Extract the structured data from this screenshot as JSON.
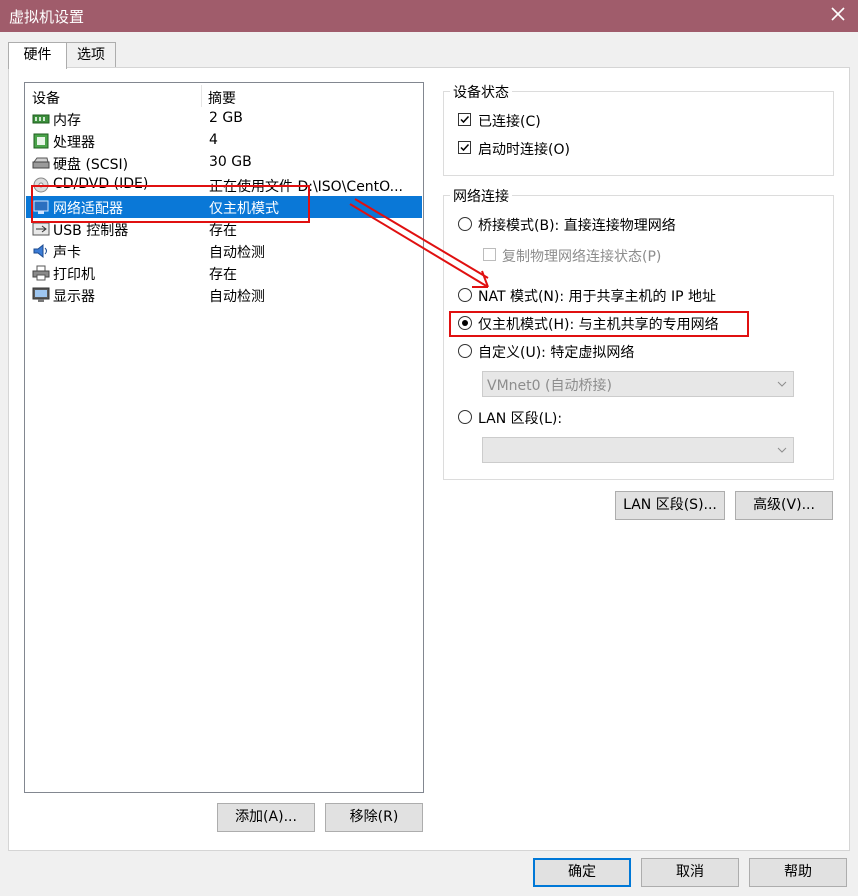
{
  "window": {
    "title": "虚拟机设置",
    "close_icon": "close-icon"
  },
  "tabs": [
    {
      "label": "硬件",
      "active": true
    },
    {
      "label": "选项",
      "active": false
    }
  ],
  "device_list": {
    "columns": [
      "设备",
      "摘要"
    ],
    "rows": [
      {
        "name": "内存",
        "summary": "2 GB",
        "icon": "memory-icon",
        "selected": false
      },
      {
        "name": "处理器",
        "summary": "4",
        "icon": "processor-icon",
        "selected": false
      },
      {
        "name": "硬盘 (SCSI)",
        "summary": "30 GB",
        "icon": "hard-disk-icon",
        "selected": false
      },
      {
        "name": "CD/DVD (IDE)",
        "summary": "正在使用文件 D:\\ISO\\CentO...",
        "icon": "cd-dvd-icon",
        "selected": false
      },
      {
        "name": "网络适配器",
        "summary": "仅主机模式",
        "icon": "network-adapter-icon",
        "selected": true
      },
      {
        "name": "USB 控制器",
        "summary": "存在",
        "icon": "usb-icon",
        "selected": false
      },
      {
        "name": "声卡",
        "summary": "自动检测",
        "icon": "sound-card-icon",
        "selected": false
      },
      {
        "name": "打印机",
        "summary": "存在",
        "icon": "printer-icon",
        "selected": false
      },
      {
        "name": "显示器",
        "summary": "自动检测",
        "icon": "display-icon",
        "selected": false
      }
    ]
  },
  "list_buttons": {
    "add": "添加(A)...",
    "remove": "移除(R)"
  },
  "device_status": {
    "title": "设备状态",
    "connected": {
      "label": "已连接(C)",
      "checked": true
    },
    "connect_at_power_on": {
      "label": "启动时连接(O)",
      "checked": true
    }
  },
  "network_connection": {
    "title": "网络连接",
    "bridged": {
      "label": "桥接模式(B): 直接连接物理网络",
      "selected": false
    },
    "replicate": {
      "label": "复制物理网络连接状态(P)",
      "checked": false,
      "enabled": false
    },
    "nat": {
      "label": "NAT 模式(N): 用于共享主机的 IP 地址",
      "selected": false
    },
    "host_only": {
      "label": "仅主机模式(H): 与主机共享的专用网络",
      "selected": true
    },
    "custom": {
      "label": "自定义(U): 特定虚拟网络",
      "selected": false
    },
    "custom_select": {
      "value": "VMnet0 (自动桥接)",
      "enabled": false
    },
    "lan_segment": {
      "label": "LAN 区段(L):",
      "selected": false
    },
    "lan_select": {
      "value": "",
      "enabled": false
    }
  },
  "panel_buttons": {
    "lan_segments": "LAN 区段(S)...",
    "advanced": "高级(V)..."
  },
  "dialog_buttons": {
    "ok": "确定",
    "cancel": "取消",
    "help": "帮助"
  },
  "colors": {
    "titlebar": "#a05c6b",
    "selection": "#0a78d7",
    "annotation": "#e01010",
    "default_button_border": "#0078d7"
  }
}
